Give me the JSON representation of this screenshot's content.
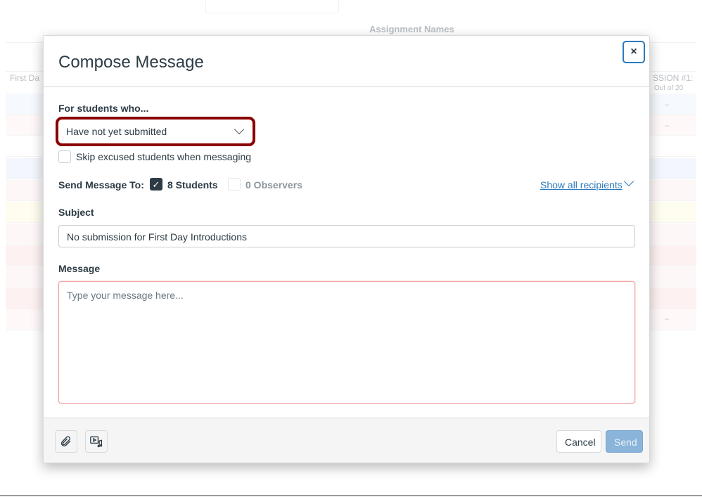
{
  "background": {
    "header_label": "Assignment Names",
    "column_left": "First Da",
    "column_right": "SSION #1: ",
    "column_right_sub": "Out of 20",
    "dash": "–"
  },
  "modal": {
    "title": "Compose Message",
    "close_label": "×",
    "filter_label": "For students who...",
    "filter_value": "Have not yet submitted",
    "skip_excused_label": "Skip excused students when messaging",
    "skip_excused_checked": false,
    "send_to_label": "Send Message To:",
    "students_label": "8 Students",
    "students_checked": true,
    "observers_label": "0 Observers",
    "observers_checked": false,
    "show_recipients": "Show all recipients",
    "subject_label": "Subject",
    "subject_value": "No submission for First Day Introductions",
    "message_label": "Message",
    "message_placeholder": "Type your message here...",
    "cancel": "Cancel",
    "send": "Send",
    "icons": [
      "paperclip-icon",
      "media-icon"
    ]
  }
}
